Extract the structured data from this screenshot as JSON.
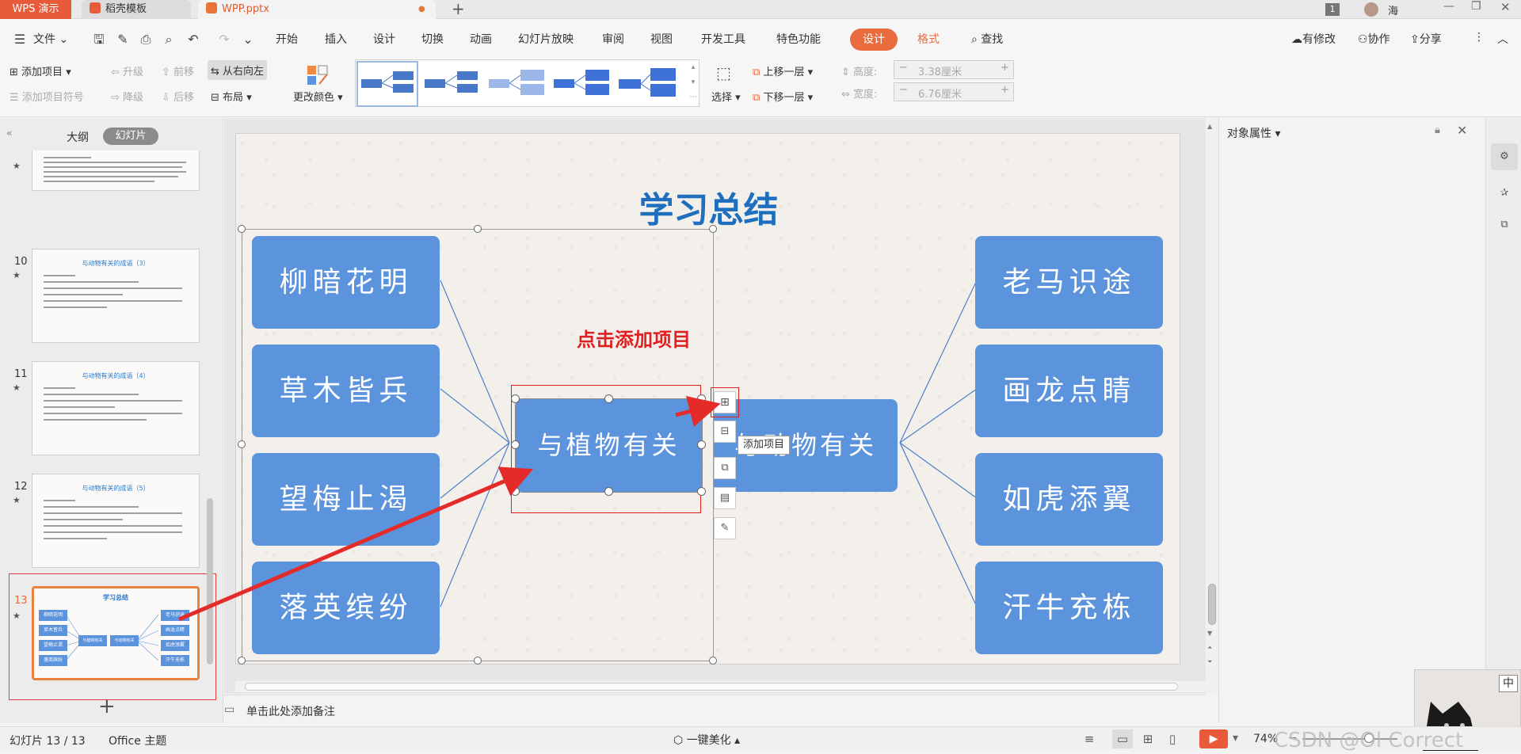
{
  "titlebar": {
    "app_tab": "WPS 演示",
    "template_tab": "稻壳模板",
    "file_tab": "WPP.pptx",
    "new_tab_symbol": "+",
    "page_badge": "1",
    "user_name": "海"
  },
  "menu": {
    "file": "文件",
    "items": [
      "开始",
      "插入",
      "设计",
      "切换",
      "动画",
      "幻灯片放映",
      "审阅",
      "视图",
      "开发工具",
      "特色功能"
    ],
    "design_tab": "设计",
    "format_tab": "格式",
    "search": "查找",
    "has_changes": "有修改",
    "collaborate": "协作",
    "share": "分享"
  },
  "ribbon": {
    "add_item": "添加项目",
    "upgrade": "升级",
    "move_forward": "前移",
    "right_to_left": "从右向左",
    "add_bullet": "添加项目符号",
    "downgrade": "降级",
    "move_back": "后移",
    "layout": "布局",
    "change_color": "更改颜色",
    "select": "选择",
    "bring_forward": "上移一层",
    "send_backward": "下移一层",
    "height_label": "高度:",
    "height_value": "3.38厘米",
    "width_label": "宽度:",
    "width_value": "6.76厘米"
  },
  "leftpanel": {
    "outline_tab": "大纲",
    "slides_tab": "幻灯片",
    "slides": [
      {
        "num": "10",
        "title": "与动物有关的成语（3）"
      },
      {
        "num": "11",
        "title": "与动物有关的成语（4）"
      },
      {
        "num": "12",
        "title": "与动物有关的成语（5）"
      },
      {
        "num": "13",
        "title": "学习总结"
      }
    ],
    "add_slide": "+"
  },
  "slide": {
    "title": "学习总结",
    "left_items": [
      "柳暗花明",
      "草木皆兵",
      "望梅止渴",
      "落英缤纷"
    ],
    "center_left": "与植物有关",
    "center_right": "与动物有关",
    "right_items": [
      "老马识途",
      "画龙点睛",
      "如虎添翼",
      "汗牛充栋"
    ],
    "annotation": "点击添加项目",
    "tooltip": "添加项目",
    "title_color": "#1f6fbf",
    "box_color": "#5c93dd",
    "annotation_color": "#e02020"
  },
  "thumb13": {
    "left": [
      "柳暗花明",
      "草木皆兵",
      "望梅止渴",
      "落英缤纷"
    ],
    "center": [
      "与植物有关",
      "与动物有关"
    ],
    "right": [
      "老马识途",
      "画龙点睛",
      "如虎添翼",
      "汗牛充栋"
    ]
  },
  "rightpanel": {
    "title": "对象属性"
  },
  "notes": {
    "placeholder": "单击此处添加备注"
  },
  "statusbar": {
    "slide_info": "幻灯片 13 / 13",
    "theme": "Office 主题",
    "beautify": "一键美化",
    "zoom": "74%",
    "watermark": "CSDN @Ol Correct",
    "ime_label": "中"
  }
}
